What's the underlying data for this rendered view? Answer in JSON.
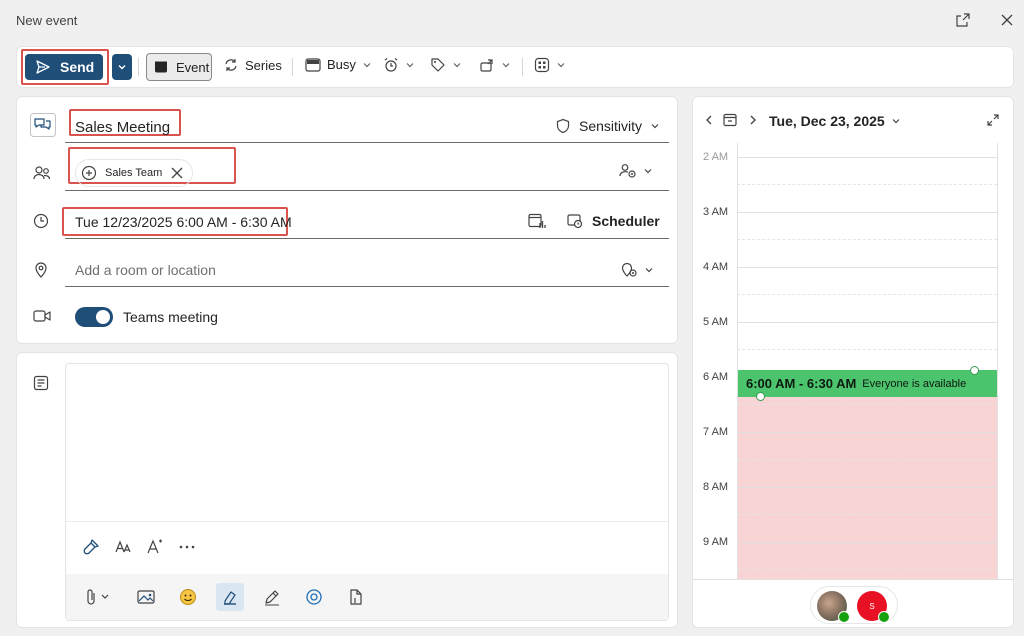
{
  "window": {
    "title": "New event"
  },
  "toolbar": {
    "send_label": "Send",
    "event_label": "Event",
    "series_label": "Series",
    "busy_label": "Busy"
  },
  "form": {
    "subject": "Sales Meeting",
    "sensitivity_label": "Sensitivity",
    "attendees": [
      {
        "label": "Sales Team"
      }
    ],
    "datetime": "Tue 12/23/2025 6:00 AM - 6:30 AM",
    "scheduler_label": "Scheduler",
    "location_placeholder": "Add a room or location",
    "teams_label": "Teams meeting",
    "teams_enabled": true
  },
  "calendar": {
    "date_label": "Tue, Dec 23, 2025",
    "hours": [
      {
        "label": "2 AM"
      },
      {
        "label": "3 AM"
      },
      {
        "label": "4 AM"
      },
      {
        "label": "5 AM"
      },
      {
        "label": "6 AM"
      },
      {
        "label": "7 AM"
      },
      {
        "label": "8 AM"
      },
      {
        "label": "9 AM"
      }
    ],
    "event": {
      "time": "6:00 AM - 6:30 AM",
      "status": "Everyone is available"
    },
    "avatars": [
      {
        "initial": "S",
        "color": "#e81123"
      }
    ]
  },
  "colors": {
    "primary": "#1f4e79",
    "available": "#4cc46d",
    "busy": "#f8d4d4",
    "highlight": "#d9534f"
  }
}
